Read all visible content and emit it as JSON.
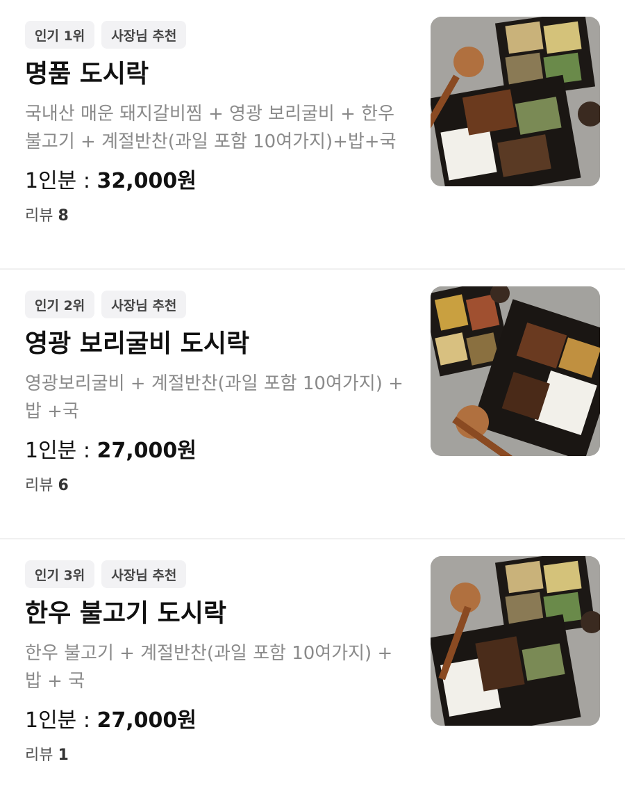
{
  "menu": [
    {
      "badges": [
        "인기 1위",
        "사장님 추천"
      ],
      "title": "명품 도시락",
      "description": "국내산 매운 돼지갈비찜 + 영광 보리굴비 + 한우 불고기 + 계절반찬(과일 포함 10여가지)+밥+국",
      "price_label": "1인분 : ",
      "price": "32,000원",
      "review_label": "리뷰 ",
      "review_count": "8",
      "image_icon": "lunchbox-photo"
    },
    {
      "badges": [
        "인기 2위",
        "사장님 추천"
      ],
      "title": "영광 보리굴비 도시락",
      "description": "영광보리굴비 + 계절반찬(과일 포함 10여가지) + 밥 +국",
      "price_label": "1인분 : ",
      "price": "27,000원",
      "review_label": "리뷰 ",
      "review_count": "6",
      "image_icon": "lunchbox-photo"
    },
    {
      "badges": [
        "인기 3위",
        "사장님 추천"
      ],
      "title": "한우 불고기 도시락",
      "description": "한우 불고기 + 계절반찬(과일 포함 10여가지) + 밥 + 국",
      "price_label": "1인분 : ",
      "price": "27,000원",
      "review_label": "리뷰 ",
      "review_count": "1",
      "image_icon": "lunchbox-photo"
    }
  ]
}
